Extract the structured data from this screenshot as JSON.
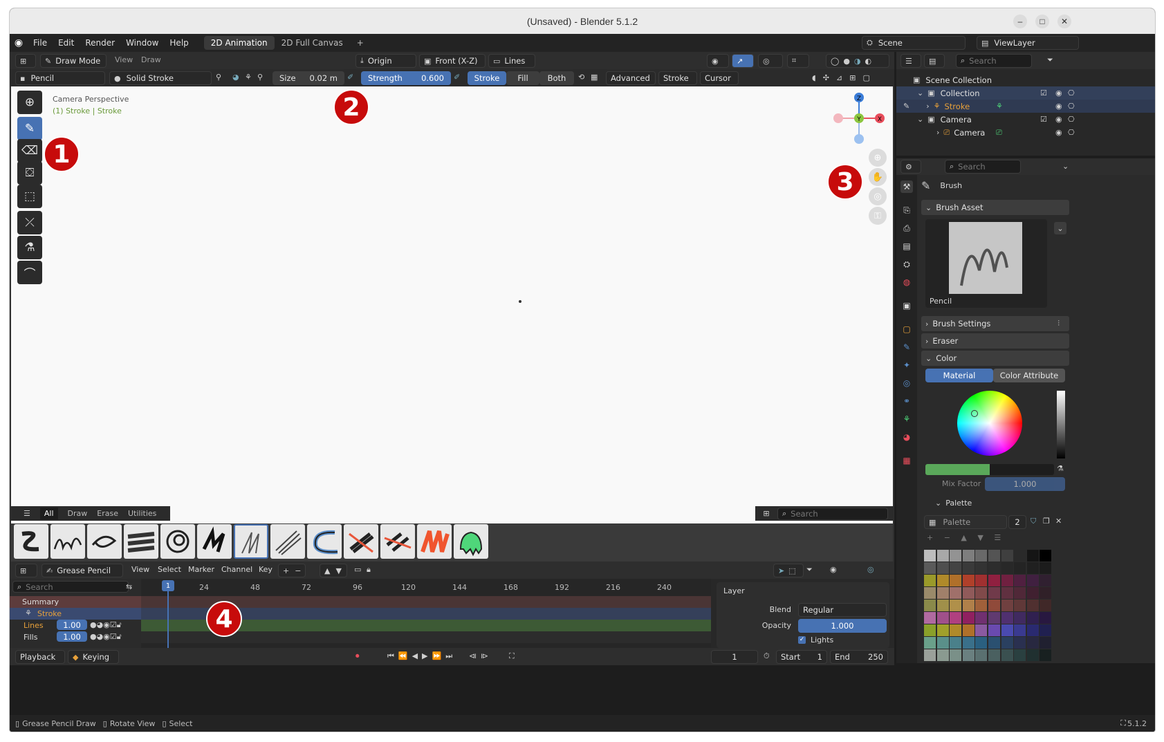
{
  "window": {
    "title": "(Unsaved) - Blender 5.1.2",
    "minimize": "–",
    "maximize": "□",
    "close": "✕"
  },
  "menu": {
    "items": [
      "File",
      "Edit",
      "Render",
      "Window",
      "Help"
    ]
  },
  "workspaces": {
    "tabs": [
      "2D Animation",
      "2D Full Canvas"
    ],
    "add": "+"
  },
  "top_right": {
    "scene": "Scene",
    "view_layer": "ViewLayer"
  },
  "viewport_header": {
    "mode": "Draw Mode",
    "view": "View",
    "draw": "Draw",
    "origin": "Origin",
    "projection": "Front (X-Z)",
    "layer_type": "Lines"
  },
  "tool_settings": {
    "brush": "Pencil",
    "material": "Solid Stroke",
    "size_label": "Size",
    "size_value": "0.02 m",
    "strength_label": "Strength",
    "strength_value": "0.600",
    "mode_stroke": "Stroke",
    "mode_fill": "Fill",
    "mode_both": "Both",
    "advanced": "Advanced",
    "stroke": "Stroke",
    "cursor": "Cursor"
  },
  "viewport": {
    "camera_label": "Camera Perspective",
    "object_label": "(1) Stroke | Stroke",
    "axis_z": "Z",
    "axis_y": "Y",
    "axis_x": "X"
  },
  "badges": {
    "b1": "1",
    "b2": "2",
    "b3": "3",
    "b4": "4"
  },
  "asset_shelf": {
    "tabs": [
      "All",
      "Draw",
      "Erase",
      "Utilities"
    ],
    "search_placeholder": "Search"
  },
  "timeline": {
    "editor": "Grease Pencil",
    "menus": [
      "View",
      "Select",
      "Marker",
      "Channel",
      "Key"
    ],
    "search_placeholder": "Search",
    "current_frame": "1",
    "ticks": [
      "24",
      "48",
      "72",
      "96",
      "120",
      "144",
      "168",
      "192",
      "216",
      "240"
    ],
    "channels": [
      {
        "name": "Summary"
      },
      {
        "name": "Stroke"
      },
      {
        "name": "Lines",
        "value": "1.00"
      },
      {
        "name": "Fills",
        "value": "1.00"
      }
    ],
    "layer_panel": {
      "title": "Layer",
      "blend_label": "Blend",
      "blend_value": "Regular",
      "opacity_label": "Opacity",
      "opacity_value": "1.000",
      "lights_label": "Lights"
    },
    "playback": "Playback",
    "keying": "Keying",
    "frame": "1",
    "start_label": "Start",
    "start_value": "1",
    "end_label": "End",
    "end_value": "250"
  },
  "outliner": {
    "search_placeholder": "Search",
    "rows": [
      "Scene Collection",
      "Collection",
      "Stroke",
      "Camera",
      "Camera"
    ]
  },
  "properties": {
    "search_placeholder": "Search",
    "brush_title": "Brush",
    "brush_asset": "Brush Asset",
    "brush_name": "Pencil",
    "brush_settings": "Brush Settings",
    "eraser": "Eraser",
    "color": "Color",
    "tab_material": "Material",
    "tab_color_attr": "Color Attribute",
    "mix_factor_label": "Mix Factor",
    "mix_factor_value": "1.000",
    "palette_section": "Palette",
    "palette_name": "Palette",
    "palette_users": "2"
  },
  "status": {
    "draw": "Grease Pencil Draw",
    "rotate": "Rotate View",
    "select": "Select",
    "version": "5.1.2"
  },
  "colors": {
    "accent": "#4772b3",
    "badge": "#c70b0b",
    "stroke_orange": "#e8a13a"
  }
}
